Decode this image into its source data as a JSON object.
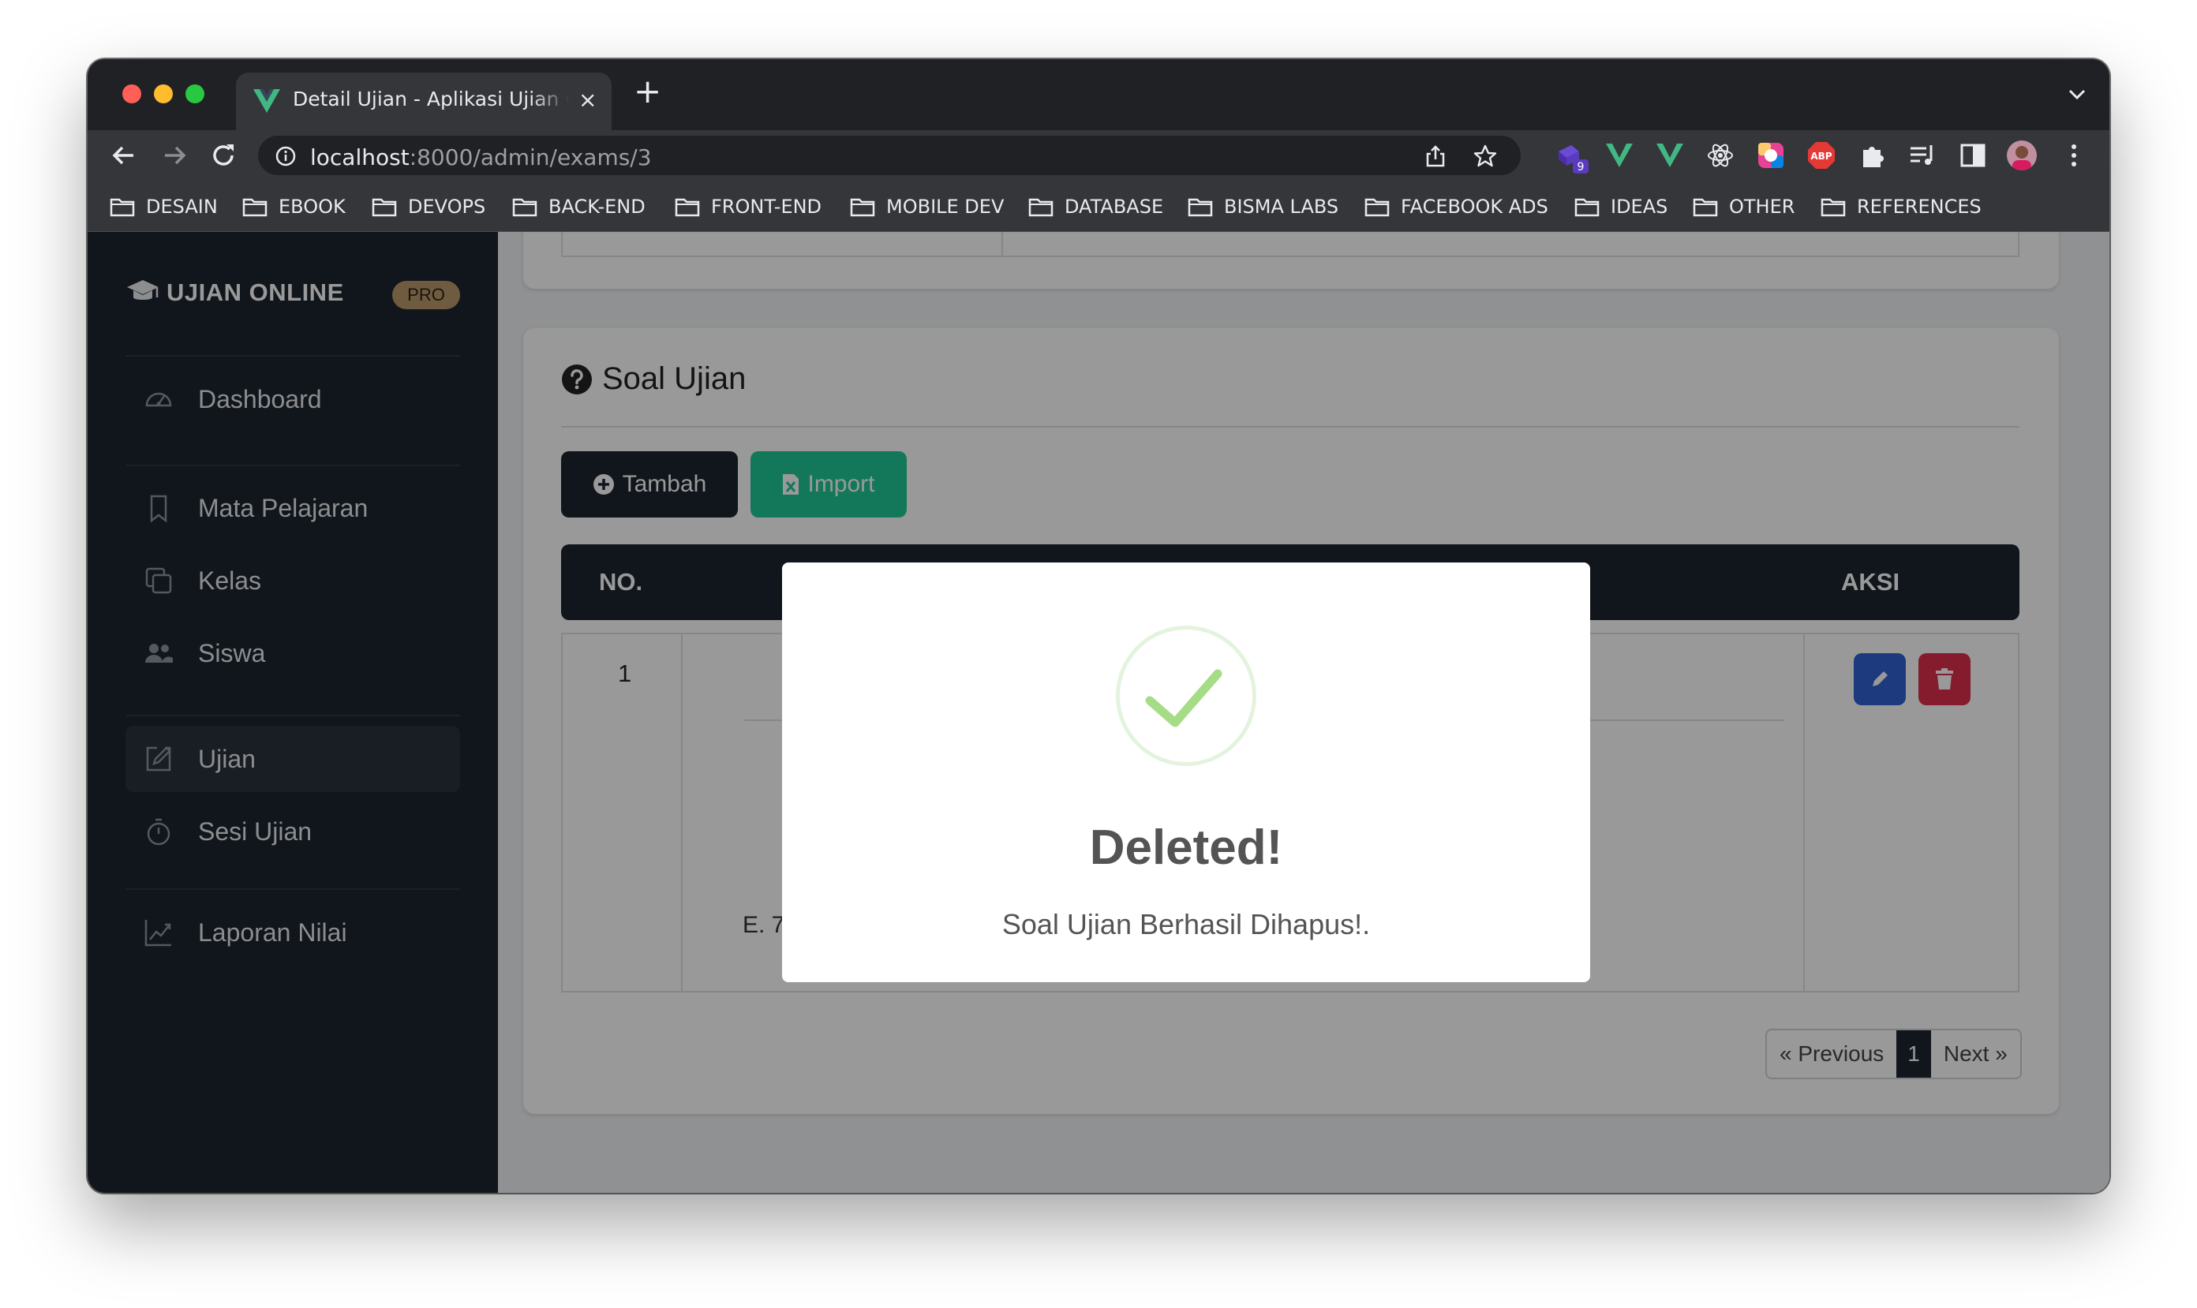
{
  "browser": {
    "tab_title": "Detail Ujian - Aplikasi Ujian Online",
    "tab_close": "×",
    "new_tab": "+",
    "url_host": "localhost",
    "url_path": ":8000/admin/exams/3",
    "extension_badge": "9",
    "bookmarks": [
      "DESAIN",
      "EBOOK",
      "DEVOPS",
      "BACK-END",
      "FRONT-END",
      "MOBILE DEV",
      "DATABASE",
      "BISMA LABS",
      "FACEBOOK ADS",
      "IDEAS",
      "OTHER",
      "REFERENCES"
    ]
  },
  "sidebar": {
    "brand": "UJIAN ONLINE",
    "badge": "PRO",
    "items": [
      {
        "label": "Dashboard",
        "icon": "dashboard-icon"
      },
      {
        "label": "Mata Pelajaran",
        "icon": "bookmark-icon"
      },
      {
        "label": "Kelas",
        "icon": "copy-icon"
      },
      {
        "label": "Siswa",
        "icon": "users-icon"
      },
      {
        "label": "Ujian",
        "icon": "edit-icon",
        "active": true
      },
      {
        "label": "Sesi Ujian",
        "icon": "stopwatch-icon"
      },
      {
        "label": "Laporan Nilai",
        "icon": "chart-icon"
      }
    ]
  },
  "questions": {
    "title": "Soal Ujian",
    "add_button": "Tambah",
    "import_button": "Import",
    "headers": {
      "no": "NO.",
      "action": "AKSI"
    },
    "rows": [
      {
        "no": "1",
        "visible_option": "E. 7"
      }
    ]
  },
  "pagination": {
    "previous": "« Previous",
    "current": "1",
    "next": "Next »"
  },
  "modal": {
    "title": "Deleted!",
    "message": "Soal Ujian Berhasil Dihapus!."
  },
  "colors": {
    "sidebar": "#1d252f",
    "import_button": "#20c997",
    "edit_button": "#2f62d1",
    "delete_button": "#dc2f4d",
    "success": "#a5dc86"
  }
}
